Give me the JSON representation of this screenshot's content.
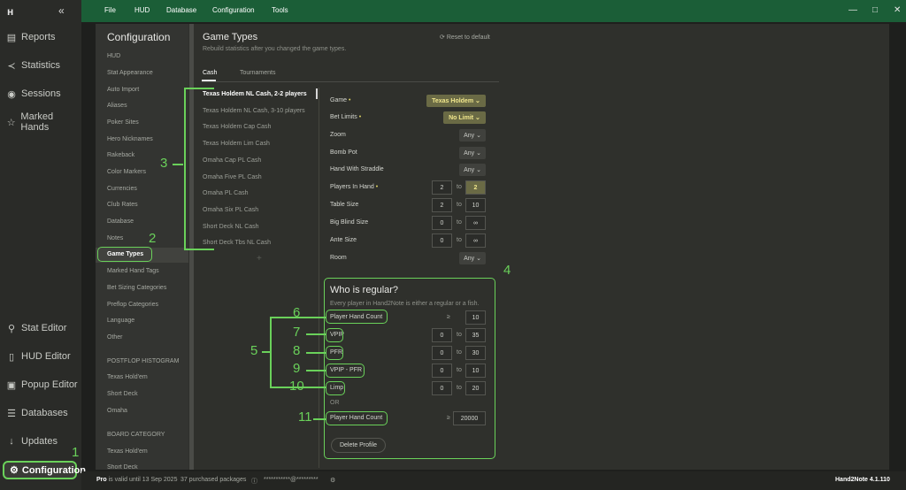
{
  "sidebar": {
    "collapse_icon": "«",
    "items": [
      {
        "icon": "document-icon",
        "label": "Reports"
      },
      {
        "icon": "statistics-icon",
        "label": "Statistics"
      },
      {
        "icon": "sessions-icon",
        "label": "Sessions"
      },
      {
        "icon": "star-icon",
        "label": "Marked Hands"
      },
      {
        "icon": "stat-editor-icon",
        "label": "Stat Editor"
      },
      {
        "icon": "hud-editor-icon",
        "label": "HUD Editor"
      },
      {
        "icon": "popup-editor-icon",
        "label": "Popup Editor"
      },
      {
        "icon": "database-icon",
        "label": "Databases"
      },
      {
        "icon": "download-icon",
        "label": "Updates"
      },
      {
        "icon": "gear-icon",
        "label": "Configuration"
      }
    ]
  },
  "menu": [
    "File",
    "HUD",
    "Database",
    "Configuration",
    "Tools"
  ],
  "config_nav": {
    "title": "Configuration",
    "items": [
      "HUD",
      "Stat Appearance",
      "Auto Import",
      "Aliases",
      "Poker Sites",
      "Hero Nicknames",
      "Rakeback",
      "Color Markers",
      "Currencies",
      "Club Rates",
      "Database",
      "Notes",
      "Game Types",
      "Marked Hand Tags",
      "Bet Sizing Categories",
      "Preflop Categories",
      "Language",
      "Other"
    ],
    "selected": "Game Types",
    "postflop_header": "POSTFLOP HISTOGRAM",
    "postflop_items": [
      "Texas Hold'em",
      "Short Deck",
      "Omaha"
    ],
    "board_header": "BOARD CATEGORY",
    "board_items": [
      "Texas Hold'em",
      "Short Deck"
    ]
  },
  "game_types": {
    "title": "Game Types",
    "subtitle": "Rebuild statistics after you changed the game types.",
    "reset_label": "Reset to default",
    "tabs": [
      "Cash",
      "Tournaments"
    ],
    "active_tab": "Cash",
    "list": [
      "Texas Holdem NL Cash, 2-2 players",
      "Texas Holdem NL Cash, 3-10 players",
      "Texas Holdem Cap Cash",
      "Texas Holdem Lim Cash",
      "Omaha Cap PL Cash",
      "Omaha Five PL Cash",
      "Omaha PL Cash",
      "Omaha Six PL Cash",
      "Short Deck NL Cash",
      "Short Deck Tbs NL Cash"
    ],
    "add_label": "+"
  },
  "fields": {
    "game": {
      "label": "Game",
      "value": "Texas Holdem"
    },
    "bet_limits": {
      "label": "Bet Limits",
      "value": "No Limit"
    },
    "zoom": {
      "label": "Zoom",
      "value": "Any"
    },
    "bomb_pot": {
      "label": "Bomb Pot",
      "value": "Any"
    },
    "straddle": {
      "label": "Hand With Straddle",
      "value": "Any"
    },
    "players": {
      "label": "Players In Hand",
      "from": "2",
      "to": "2"
    },
    "table_size": {
      "label": "Table Size",
      "from": "2",
      "to": "10"
    },
    "bb_size": {
      "label": "Big Blind Size",
      "from": "0",
      "to": "∞"
    },
    "ante": {
      "label": "Ante Size",
      "from": "0",
      "to": "∞"
    },
    "room": {
      "label": "Room",
      "value": "Any"
    },
    "to_word": "to"
  },
  "regular": {
    "title": "Who is regular?",
    "subtitle": "Every player in Hand2Note is either a regular or a fish.",
    "hand_count": {
      "label": "Player Hand Count",
      "sign": "≥",
      "value": "10"
    },
    "vpip": {
      "label": "VPIP",
      "from": "0",
      "to": "35"
    },
    "pfr": {
      "label": "PFR",
      "from": "0",
      "to": "30"
    },
    "vpip_pfr": {
      "label": "VPIP - PFR",
      "from": "0",
      "to": "10"
    },
    "limp": {
      "label": "Limp",
      "from": "0",
      "to": "20"
    },
    "or_label": "OR",
    "hand_count2": {
      "label": "Player Hand Count",
      "sign": "≥",
      "value": "20000"
    },
    "delete_label": "Delete Profile"
  },
  "annotations": [
    "1",
    "2",
    "3",
    "4",
    "5",
    "6",
    "7",
    "8",
    "9",
    "10",
    "11"
  ],
  "status": {
    "pro": "Pro",
    "valid": "is valid until 13 Sep 2025",
    "packages": "37 purchased packages",
    "email": "***********@*********",
    "version": "Hand2Note 4.1.110"
  }
}
